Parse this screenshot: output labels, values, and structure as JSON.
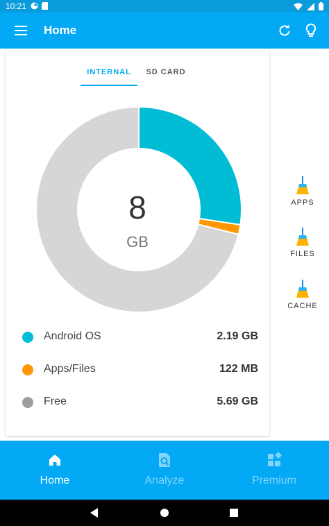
{
  "status_bar": {
    "time": "10:21"
  },
  "app_bar": {
    "title": "Home"
  },
  "tabs": [
    {
      "label": "INTERNAL",
      "active": true
    },
    {
      "label": "SD CARD",
      "active": false
    }
  ],
  "storage": {
    "total_value": "8",
    "total_unit": "GB",
    "items": [
      {
        "label": "Android OS",
        "value": "2.19 GB",
        "color": "#00bcd4"
      },
      {
        "label": "Apps/Files",
        "value": "122 MB",
        "color": "#ff9800"
      },
      {
        "label": "Free",
        "value": "5.69 GB",
        "color": "#9e9e9e"
      }
    ]
  },
  "chart_data": {
    "type": "pie",
    "categories": [
      "Android OS",
      "Apps/Files",
      "Free"
    ],
    "values": [
      2.19,
      0.122,
      5.69
    ],
    "colors": [
      "#00bcd4",
      "#ff9800",
      "#d6d6d6"
    ],
    "title": "",
    "donut": true
  },
  "side_actions": [
    {
      "label": "APPS",
      "icon": "broom-icon"
    },
    {
      "label": "FILES",
      "icon": "broom-icon"
    },
    {
      "label": "CACHE",
      "icon": "broom-icon"
    }
  ],
  "bottom_nav": {
    "items": [
      {
        "label": "Home",
        "icon": "home-icon",
        "active": true
      },
      {
        "label": "Analyze",
        "icon": "analyze-icon",
        "active": false
      },
      {
        "label": "Premium",
        "icon": "premium-icon",
        "active": false
      }
    ]
  },
  "colors": {
    "primary": "#03a9f4",
    "status_bar": "#0a9bdc",
    "nav_inactive": "#81d4fa"
  }
}
